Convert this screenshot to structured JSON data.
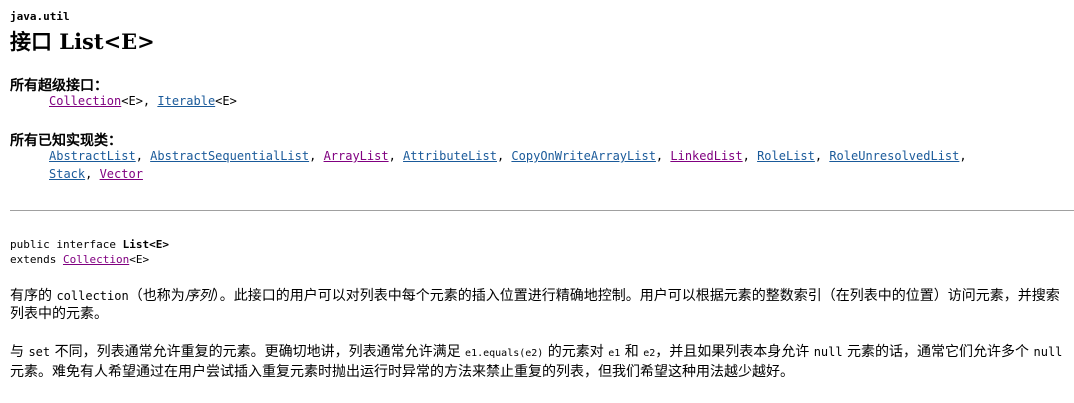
{
  "package": "java.util",
  "title": "接口 List<E>",
  "superinterfaces": {
    "heading": "所有超级接口：",
    "items": [
      {
        "name": "Collection",
        "suffix": "<E>, "
      },
      {
        "name": "Iterable",
        "suffix": "<E>"
      }
    ]
  },
  "implementing_classes": {
    "heading": "所有已知实现类：",
    "items": [
      {
        "name": "AbstractList",
        "sep": ", "
      },
      {
        "name": "AbstractSequentialList",
        "sep": ", "
      },
      {
        "name": "ArrayList",
        "sep": ", "
      },
      {
        "name": "AttributeList",
        "sep": ", "
      },
      {
        "name": "CopyOnWriteArrayList",
        "sep": ", "
      },
      {
        "name": "LinkedList",
        "sep": ", "
      },
      {
        "name": "RoleList",
        "sep": ", "
      },
      {
        "name": "RoleUnresolvedList",
        "sep": ","
      },
      {
        "name": "Stack",
        "sep": ", "
      },
      {
        "name": "Vector",
        "sep": ""
      }
    ]
  },
  "declaration": {
    "line1_prefix": "public interface ",
    "line1_name": "List<E>",
    "line2_prefix": "extends ",
    "line2_link": "Collection",
    "line2_suffix": "<E>"
  },
  "paragraph1": {
    "p1": "有序的 ",
    "c1": "collection",
    "p2": "（也称为",
    "em1": "序列",
    "p3": "）。此接口的用户可以对列表中每个元素的插入位置进行精确地控制。用户可以根据元素的整数索引（在列表中的位置）访问元素，并搜索列表中的元素。"
  },
  "paragraph2": {
    "p1": "与 ",
    "c1": "set",
    "p2": " 不同，列表通常允许重复的元素。更确切地讲，列表通常允许满足 ",
    "c2": "e1.equals(e2)",
    "p3": " 的元素对 ",
    "c3": "e1",
    "p4": " 和 ",
    "c4": "e2",
    "p5": "，并且如果列表本身允许 ",
    "c5": "null",
    "p6": " 元素的话，通常它们允许多个 ",
    "c6": "null",
    "p7": " 元素。难免有人希望通过在用户尝试插入重复元素时抛出运行时异常的方法来禁止重复的列表，但我们希望这种用法越少越好。"
  }
}
